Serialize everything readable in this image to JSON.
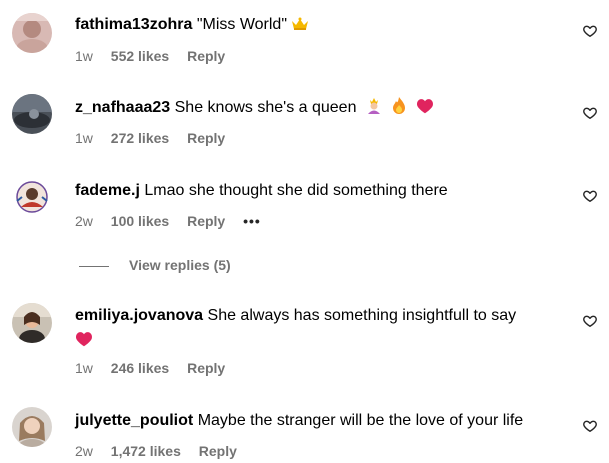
{
  "comments": [
    {
      "username": "fathima13zohra",
      "text": "\"Miss World\"",
      "emoji": "crown-icon",
      "time": "1w",
      "likes": "552 likes",
      "reply": "Reply"
    },
    {
      "username": "z_nafhaaa23",
      "text": "She knows she's a queen",
      "emoji": "princess-fire-heart-icons",
      "time": "1w",
      "likes": "272 likes",
      "reply": "Reply"
    },
    {
      "username": "fademe.j",
      "text": "Lmao she thought she did something there",
      "time": "2w",
      "likes": "100 likes",
      "reply": "Reply",
      "more": "•••",
      "view_replies": "View replies (5)"
    },
    {
      "username": "emiliya.jovanova",
      "text": "She always has something insightfull to say",
      "emoji": "red-heart-icon",
      "time": "1w",
      "likes": "246 likes",
      "reply": "Reply"
    },
    {
      "username": "julyette_pouliot",
      "text": "Maybe the stranger will be the love of your life",
      "time": "2w",
      "likes": "1,472 likes",
      "reply": "Reply"
    }
  ],
  "colors": {
    "secondary_text": "#737373",
    "heart_red": "#e0245e",
    "text": "#000000"
  }
}
